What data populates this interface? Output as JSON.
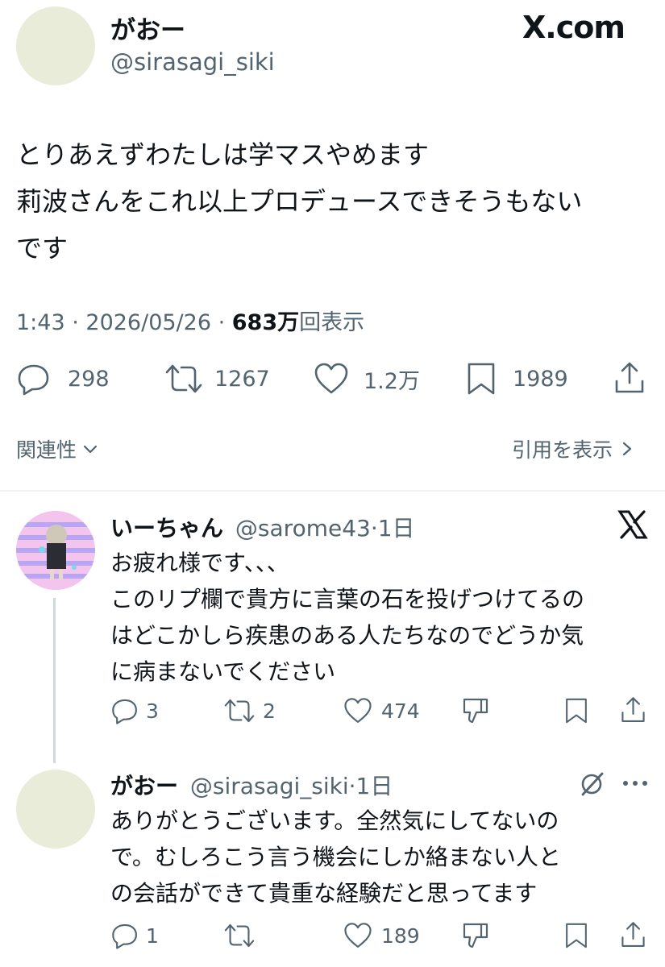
{
  "main_tweet": {
    "display_name": "がおー",
    "handle": "@sirasagi_siki",
    "brand": "X.com",
    "text_lines": [
      "とりあえずわたしは学マスやめます",
      "莉波さんをこれ以上プロデュースできそうもない",
      "です"
    ],
    "meta": {
      "time": "1:43",
      "sep1": " · ",
      "date": "2026/05/26",
      "sep2": " · ",
      "views_count": "683万",
      "views_label": "回表示"
    },
    "actions": {
      "replies": "298",
      "retweets": "1267",
      "likes": "1.2万",
      "bookmarks": "1989"
    }
  },
  "filters": {
    "relevance": "関連性",
    "quotes": "引用を表示"
  },
  "replies": [
    {
      "display_name": "いーちゃん",
      "handle": "@sarome43",
      "time": "·1日",
      "text_lines": [
        "お疲れ様です、、、",
        "このリプ欄で貴方に言葉の石を投げつけてるの",
        "はどこかしら疾患のある人たちなのでどうか気",
        "に病まないでください"
      ],
      "actions": {
        "replies": "3",
        "retweets": "2",
        "likes": "474"
      }
    },
    {
      "display_name": "がおー",
      "handle": "@sirasagi_siki",
      "time": "·1日",
      "text_lines": [
        "ありがとうございます。全然気にしてないの",
        "で。むしろこう言う機会にしか絡まない人と",
        "の会話ができて貴重な経験だと思ってます"
      ],
      "actions": {
        "replies": "1",
        "likes": "189"
      }
    }
  ],
  "colors": {
    "text": "#0f1419",
    "muted": "#536471",
    "divider": "#eff3f4",
    "avatar_bg": "#e9ecd8"
  }
}
